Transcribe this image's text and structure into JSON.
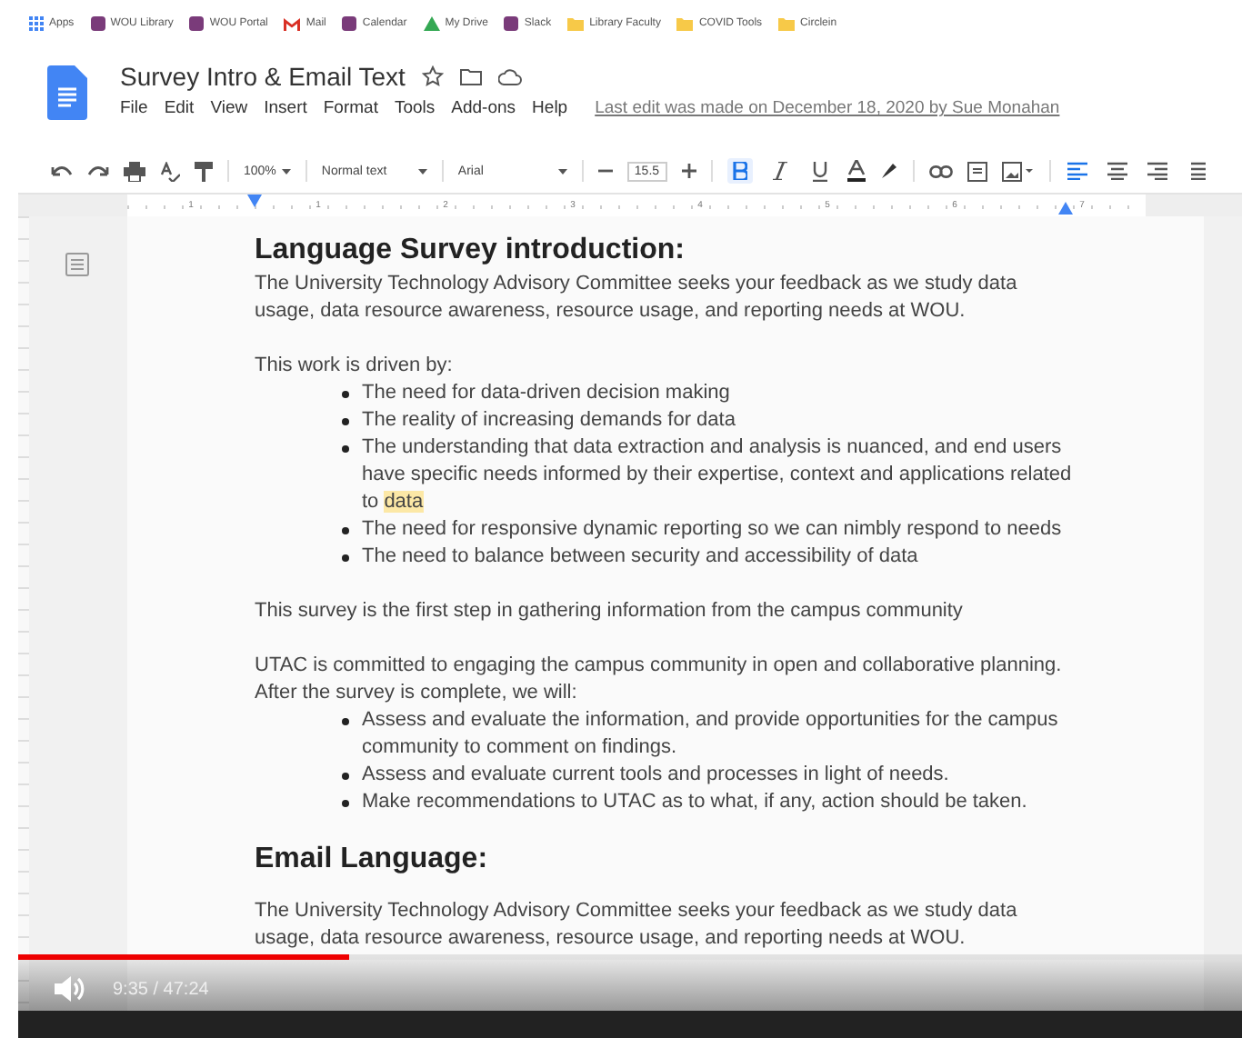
{
  "bookmarks": [
    {
      "label": "Apps",
      "kind": "apps"
    },
    {
      "label": "WOU Library",
      "kind": "site"
    },
    {
      "label": "WOU Portal",
      "kind": "site"
    },
    {
      "label": "Mail",
      "kind": "mail"
    },
    {
      "label": "Calendar",
      "kind": "site"
    },
    {
      "label": "My Drive",
      "kind": "drive"
    },
    {
      "label": "Slack",
      "kind": "site"
    },
    {
      "label": "Library Faculty",
      "kind": "folder"
    },
    {
      "label": "COVID Tools",
      "kind": "folder"
    },
    {
      "label": "Circlein",
      "kind": "folder"
    }
  ],
  "doc": {
    "title": "Survey Intro & Email Text",
    "starred": false
  },
  "menu": [
    "File",
    "Edit",
    "View",
    "Insert",
    "Format",
    "Tools",
    "Add-ons",
    "Help"
  ],
  "last_edit": "Last edit was made on December 18, 2020 by Sue Monahan",
  "toolbar": {
    "zoom": "100%",
    "style": "Normal text",
    "font": "Arial",
    "size": "15.5",
    "bold": true,
    "italic": false,
    "underline": false,
    "aligns": [
      {
        "selected": true
      },
      {
        "selected": false
      },
      {
        "selected": false
      },
      {
        "selected": false
      }
    ]
  },
  "ruler": [
    "1",
    "1",
    "2",
    "3",
    "4",
    "5",
    "6",
    "7"
  ],
  "blocks": [
    {
      "kind": "heading",
      "text": "Language Survey introduction:"
    },
    {
      "kind": "paragraph",
      "text": "The University Technology Advisory Committee seeks your feedback as we study data usage, data resource awareness, resource usage, and reporting needs at WOU."
    },
    {
      "kind": "paragraph",
      "text": "This work is driven by:"
    },
    {
      "kind": "bullets",
      "items": [
        {
          "text": "The need for data-driven decision making"
        },
        {
          "text": "The reality of increasing demands for data"
        },
        {
          "text": "The understanding that data extraction and analysis is nuanced, and end users have specific needs informed by their expertise, context and applications related to",
          "highlight": "data"
        },
        {
          "text": "The need for responsive dynamic reporting so we can nimbly respond to needs"
        },
        {
          "text": "The need to balance between security and accessibility of data"
        }
      ]
    },
    {
      "kind": "paragraph",
      "text": "This survey is the first step in gathering information from the campus community"
    },
    {
      "kind": "paragraph",
      "text": "UTAC is committed to engaging the campus community in open and collaborative planning. After the survey is complete, we will:"
    },
    {
      "kind": "bullets",
      "items": [
        {
          "text": "Assess and evaluate the information, and provide opportunities for the campus community to comment on findings."
        },
        {
          "text": "Assess and evaluate current tools and processes in light of needs."
        },
        {
          "text": "Make recommendations to UTAC as to what, if any, action should be taken."
        }
      ]
    },
    {
      "kind": "heading",
      "text": "Email Language:"
    },
    {
      "kind": "paragraph",
      "text": "The University Technology Advisory Committee seeks your feedback as we study data usage, data resource awareness, resource usage, and reporting needs at WOU."
    }
  ],
  "player": {
    "level": 0.27,
    "time": "9:35 / 47:24"
  }
}
